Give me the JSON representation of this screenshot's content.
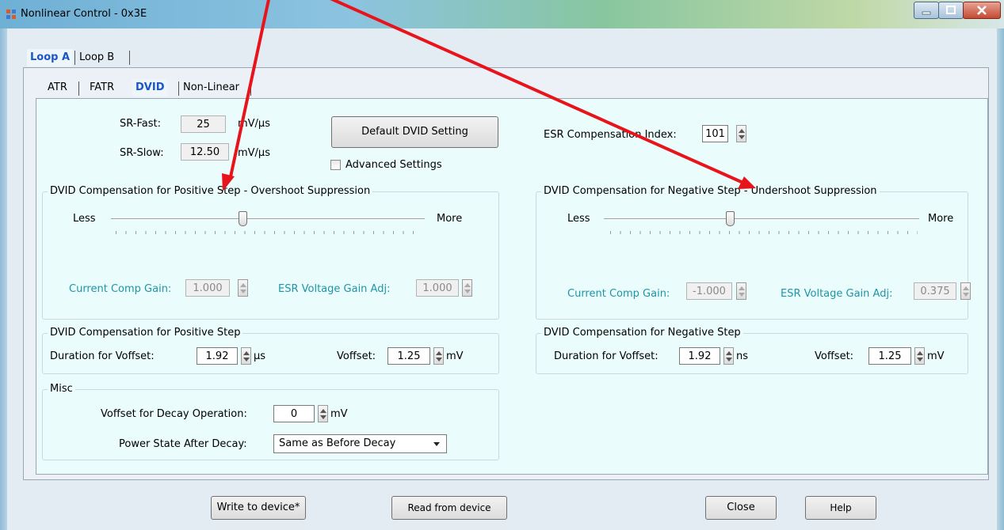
{
  "window": {
    "title": "Nonlinear Control - 0x3E"
  },
  "outer_tabs": [
    {
      "label": "Loop A",
      "selected": true
    },
    {
      "label": "Loop B",
      "selected": false
    }
  ],
  "inner_tabs": [
    {
      "label": "ATR"
    },
    {
      "label": "FATR"
    },
    {
      "label": "DVID",
      "selected": true
    },
    {
      "label": "Non-Linear"
    }
  ],
  "top": {
    "sr_fast": {
      "label": "SR-Fast:",
      "value": "25",
      "unit": "mV/µs"
    },
    "sr_slow": {
      "label": "SR-Slow:",
      "value": "12.50",
      "unit": "mV/µs"
    },
    "default_button": "Default DVID Setting",
    "advanced_label": "Advanced Settings",
    "esr_index": {
      "label": "ESR Compensation Index:",
      "value": "101"
    }
  },
  "pos_suppression": {
    "title": "DVID Compensation for Positive Step - Overshoot Suppression",
    "less": "Less",
    "more": "More",
    "slider_fraction": 0.42,
    "current_comp": {
      "label": "Current Comp Gain:",
      "value": "1.000"
    },
    "esr_gain": {
      "label": "ESR Voltage Gain Adj:",
      "value": "1.000"
    }
  },
  "neg_suppression": {
    "title": "DVID Compensation for Negative Step - Undershoot Suppression",
    "less": "Less",
    "more": "More",
    "slider_fraction": 0.4,
    "current_comp": {
      "label": "Current Comp Gain:",
      "value": "-1.000"
    },
    "esr_gain": {
      "label": "ESR Voltage Gain Adj:",
      "value": "0.375"
    }
  },
  "pos_step": {
    "title": "DVID Compensation for Positive Step",
    "duration": {
      "label": "Duration for Voffset:",
      "value": "1.92",
      "unit": "µs"
    },
    "voffset": {
      "label": "Voffset:",
      "value": "1.25",
      "unit": "mV"
    }
  },
  "neg_step": {
    "title": "DVID Compensation for Negative Step",
    "duration": {
      "label": "Duration for Voffset:",
      "value": "1.92",
      "unit": "ns"
    },
    "voffset": {
      "label": "Voffset:",
      "value": "1.25",
      "unit": "mV"
    }
  },
  "misc": {
    "title": "Misc",
    "decay": {
      "label": "Voffset for Decay Operation:",
      "value": "0",
      "unit": "mV"
    },
    "power_state": {
      "label": "Power State After Decay:",
      "value": "Same as Before Decay"
    }
  },
  "buttons": {
    "write": "Write to device*",
    "read": "Read from device",
    "close": "Close",
    "help": "Help"
  },
  "colors": {
    "annotation_arrow": "#e8141c",
    "teal_label": "#1e95a6",
    "selected_tab": "#1b56c7"
  }
}
